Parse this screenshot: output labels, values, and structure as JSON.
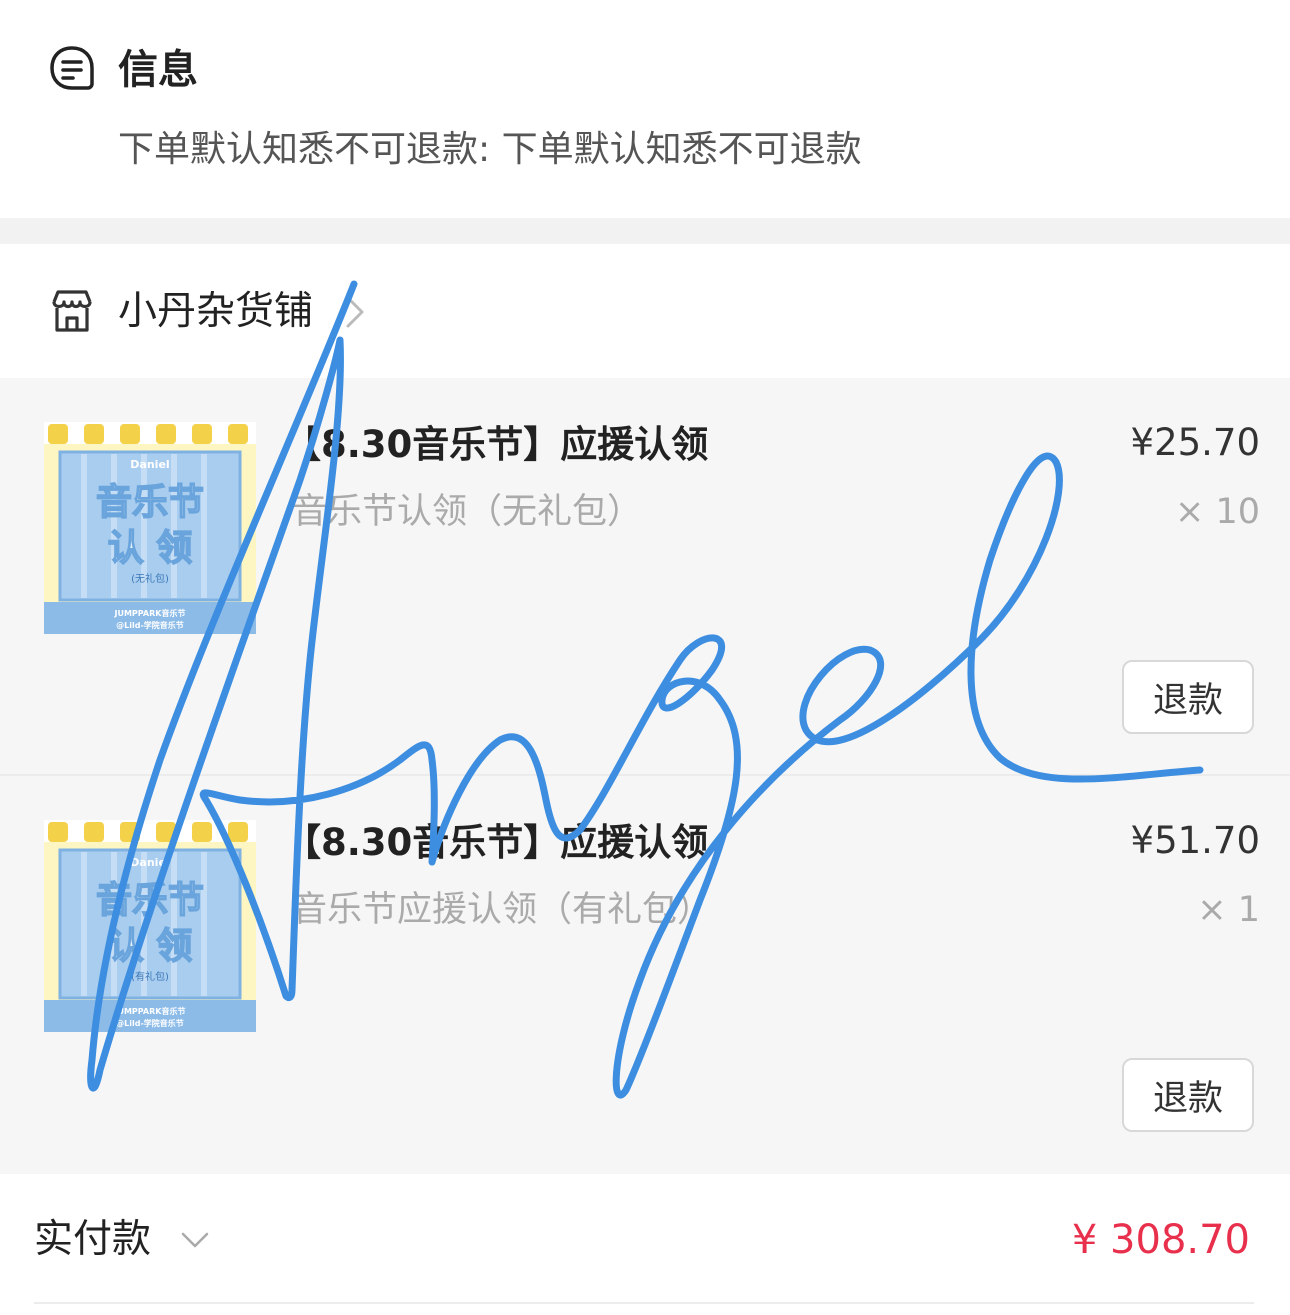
{
  "info": {
    "title": "信息",
    "text": "下单默认知悉不可退款: 下单默认知悉不可退款"
  },
  "shop": {
    "name": "小丹杂货铺"
  },
  "items": [
    {
      "title": "【8.30音乐节】应援认领",
      "spec": "音乐节认领（无礼包）",
      "price": "¥25.70",
      "qty": "× 10",
      "refund_label": "退款",
      "thumb": {
        "brand": "Daniel",
        "line1": "音乐节",
        "line2": "认 领",
        "note": "(无礼包)",
        "footer1": "JUMPPARK音乐节",
        "footer2": "@Lild-学院音乐节"
      }
    },
    {
      "title": "【8.30音乐节】应援认领",
      "spec": "音乐节应援认领（有礼包）",
      "price": "¥51.70",
      "qty": "× 1",
      "refund_label": "退款",
      "thumb": {
        "brand": "Daniel",
        "line1": "音乐节",
        "line2": "认 领",
        "note": "(有礼包)",
        "footer1": "JUMPPARK音乐节",
        "footer2": "@Lild-学院音乐节"
      }
    }
  ],
  "total": {
    "label": "实付款",
    "amount": "¥ 308.70"
  },
  "signature": {
    "text": "Angel",
    "color": "#3d8ee0"
  },
  "colors": {
    "price_red": "#e8304d",
    "thumb_blue": "#a9cdef",
    "thumb_yellow": "#fdf6c3"
  }
}
